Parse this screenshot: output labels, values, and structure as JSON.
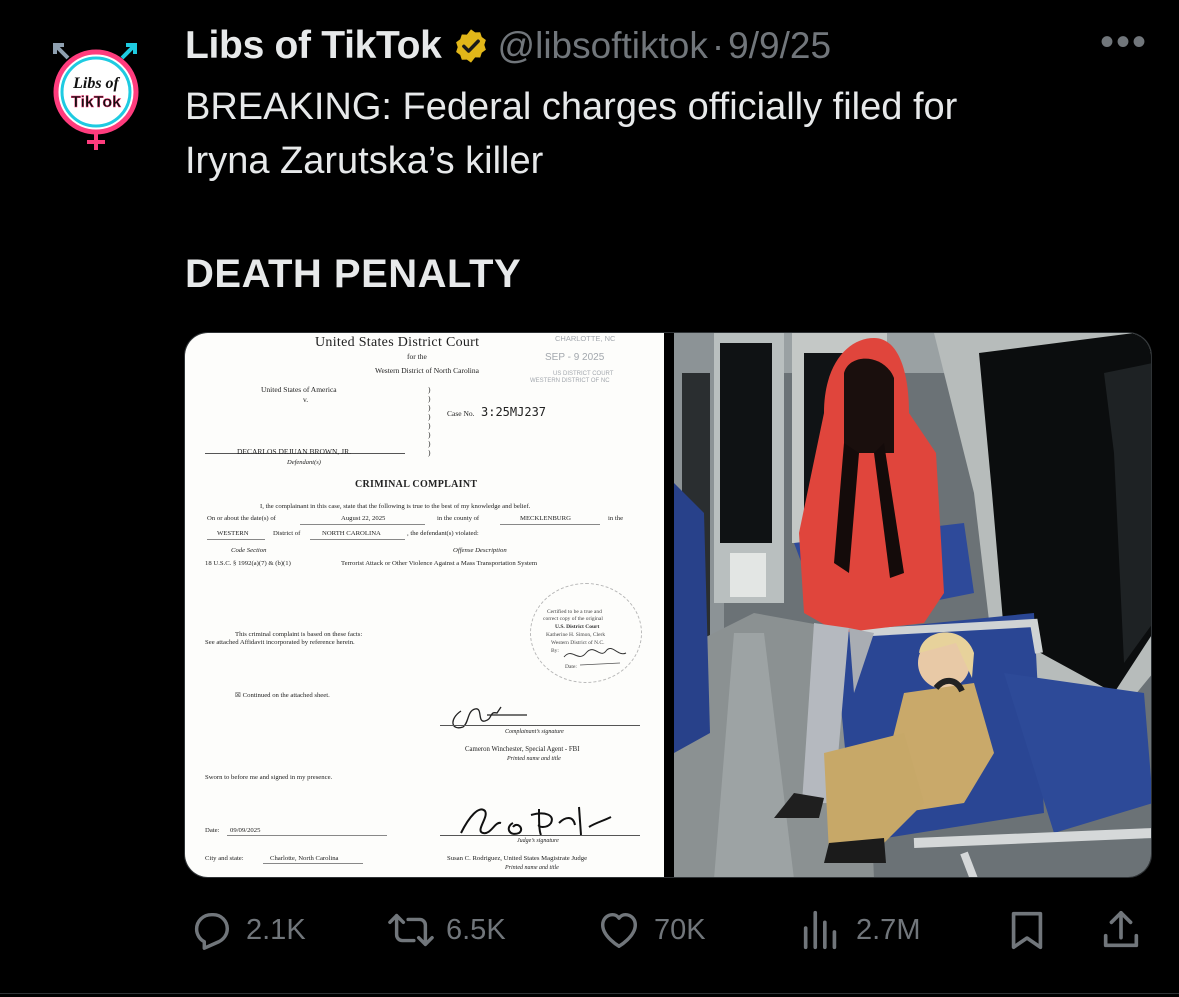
{
  "post": {
    "author_name": "Libs of TikTok",
    "verified_badge_icon": "verified-gold-badge-icon",
    "handle": "@libsoftiktok",
    "separator": "·",
    "date": "9/9/25",
    "more_label": "•••",
    "text_line1": "BREAKING: Federal charges officially filed for",
    "text_line2": "Iryna Zarutska’s killer",
    "headline": "DEATH PENALTY"
  },
  "avatar": {
    "line1": "Libs of",
    "line2": "TikTok"
  },
  "document": {
    "court": "United States District Court",
    "for_the": "for the",
    "district": "Western District of North Carolina",
    "stamp_city": "CHARLOTTE, NC",
    "stamp_date": "SEP - 9 2025",
    "stamp_office1": "US DISTRICT COURT",
    "stamp_office2": "WESTERN DISTRICT OF NC",
    "plaintiff": "United States of America",
    "v": "v.",
    "case_no_label": "Case No.",
    "case_no": "3:25MJ237",
    "defendant": "DECARLOS DEJUAN BROWN, JR.",
    "defendant_label": "Defendant(s)",
    "title": "CRIMINAL COMPLAINT",
    "intro": "I, the complainant in this case, state that the following is true to the best of my knowledge and belief.",
    "on_or_about": "On or about the date(s) of",
    "date_of": "August 22, 2025",
    "in_county_of": "in the county of",
    "county": "MECKLENBURG",
    "in_the": "in the",
    "district_name": "WESTERN",
    "district_of": "District of",
    "state": "NORTH CAROLINA",
    "violated": ", the defendant(s) violated:",
    "code_section_label": "Code Section",
    "offense_label": "Offense Description",
    "code_section": "18 U.S.C. § 1992(a)(7) & (b)(1)",
    "offense": "Terrorist Attack or Other Violence Against a Mass Transportation System",
    "seal1": "Certified to be a true and",
    "seal2": "correct copy of the original",
    "seal3": "U.S. District Court",
    "seal4": "Katherine H. Simon, Clerk",
    "seal5": "Western District of N.C.",
    "seal6": "By:",
    "seal7": "Date:",
    "based_on": "This criminal complaint is based on these facts:",
    "affidavit": "See attached Affidavit incorporated by reference herein.",
    "continued": "☒   Continued on the attached sheet.",
    "complainant_sig_label": "Complainant’s signature",
    "complainant_name": "Cameron Winchester, Special Agent - FBI",
    "printed_name_label": "Printed name and title",
    "sworn": "Sworn to before me and signed in my presence.",
    "date_label": "Date:",
    "date_value": "09/09/2025",
    "judge_sig_label": "Judge’s signature",
    "city_label": "City and state:",
    "city_value": "Charlotte, North Carolina",
    "judge_name": "Susan C. Rodriguez, United States Magistrate Judge",
    "judge_printed_label": "Printed name and title"
  },
  "actions": {
    "replies": "2.1K",
    "reposts": "6.5K",
    "likes": "70K",
    "views": "2.7M"
  },
  "icons": {
    "reply": "reply-bubble-icon",
    "repost": "repost-arrows-icon",
    "like": "heart-icon",
    "views": "views-bar-chart-icon",
    "bookmark": "bookmark-icon",
    "share": "share-upload-icon"
  },
  "colors": {
    "background": "#000000",
    "text": "#e7e9ea",
    "muted": "#71767b",
    "verified_gold": "#e2b719",
    "avatar_pink": "#ff3c7d",
    "avatar_cyan": "#1ecbe1",
    "hoodie_red": "#e0453c"
  }
}
